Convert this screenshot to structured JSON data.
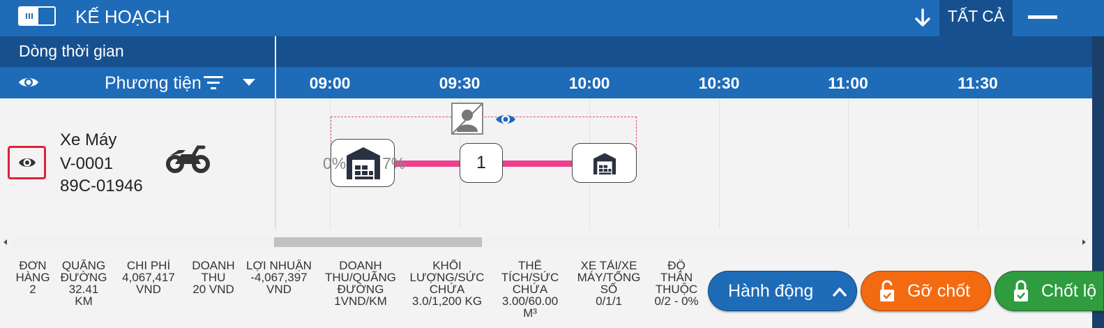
{
  "header": {
    "title": "KẾ HOẠCH",
    "filter_all_label": "TẤT CẢ",
    "accent_color": "#1e6bb8",
    "dark_color": "#17508f"
  },
  "timeline": {
    "section_label": "Dòng thời gian",
    "column_label": "Phương tiện",
    "ticks": [
      "09:00",
      "09:30",
      "10:00",
      "10:30",
      "11:00",
      "11:30"
    ]
  },
  "vehicle": {
    "name": "Xe Máy",
    "code": "V-0001",
    "plate": "89C-01946",
    "icon": "motorcycle-icon"
  },
  "route": {
    "start_pct_left": "0%",
    "start_pct_right": "7%",
    "stop_number": "1",
    "line_color": "#ec3f8e"
  },
  "scrollbar": {
    "position_fraction": 0.25
  },
  "stats": [
    {
      "key": "Đơn hàng",
      "value": "2"
    },
    {
      "key": "Quãng đường",
      "value": "32.41 KM"
    },
    {
      "key": "Chi phí",
      "value": "4,067,417 VND"
    },
    {
      "key": "Doanh thu",
      "value": "20 VND"
    },
    {
      "key": "Lợi nhuận",
      "value": "-4,067,397 VND"
    },
    {
      "key": "Doanh thu/Quãng đường",
      "value": "1VND/KM"
    },
    {
      "key": "Khối lượng/Sức chứa",
      "value": "3.0/1,200 KG"
    },
    {
      "key": "Thể tích/Sức chứa",
      "value": "3.00/60.00 M³"
    },
    {
      "key": "Xe tải/Xe máy/Tổng số",
      "value": "0/1/1"
    },
    {
      "key": "Độ thân thuộc",
      "value": "0/2 - 0%"
    }
  ],
  "actions": {
    "action_label": "Hành động",
    "unlock_label": "Gỡ chốt",
    "lock_label": "Chốt lộ",
    "action_color": "#1e6bb8",
    "unlock_color": "#f46a11",
    "lock_color": "#2e9c3f"
  }
}
